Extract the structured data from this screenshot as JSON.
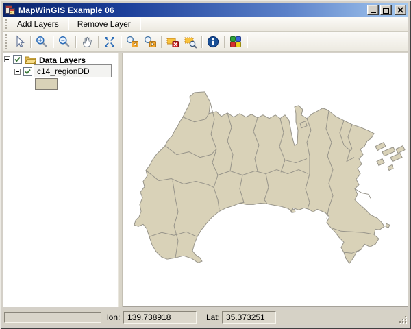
{
  "window": {
    "title": "MapWinGIS Example 06"
  },
  "window_controls": {
    "minimize": "minimize",
    "maximize": "maximize",
    "close": "close"
  },
  "menu_toolbar": {
    "add_layers": "Add Layers",
    "remove_layer": "Remove Layer"
  },
  "tool_toolbar": {
    "icons": [
      "cursor-arrow",
      "zoom-in",
      "zoom-out",
      "pan-hand",
      "zoom-full-extent",
      "zoom-previous",
      "zoom-next",
      "clear-selection",
      "zoom-to-selection",
      "identify-info",
      "symbology-colors"
    ]
  },
  "legend_panel": {
    "root": {
      "label": "Data Layers",
      "checked": true
    },
    "layer": {
      "label": "c14_regionDD",
      "checked": true,
      "swatch_color": "#d9d2b8"
    }
  },
  "map": {
    "fill": "#d9d2b8",
    "stroke": "#97948a",
    "background": "#ffffff"
  },
  "status_bar": {
    "lon_label": "lon:",
    "lon_value": "139.738918",
    "lat_label": "Lat:",
    "lat_value": "35.373251"
  },
  "colors": {
    "titlebar_start": "#0a246a",
    "titlebar_end": "#a6caf0",
    "chrome": "#d4d0c8"
  }
}
